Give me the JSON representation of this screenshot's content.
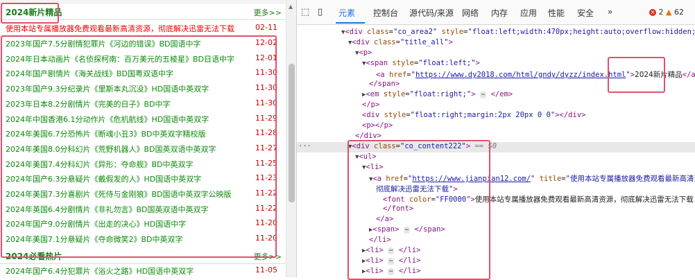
{
  "left": {
    "section1": {
      "title": "2024新片精品",
      "more": "更多>>"
    },
    "ad": {
      "title": "使用本站专属播放器免费观看最新高清资源，彻底解决迅雷无法下载",
      "date": "02-11"
    },
    "rows": [
      {
        "title": "2023年国产7.5分剧情犯罪片《河边的错误》BD国语中字",
        "date": "12-02"
      },
      {
        "title": "2024年日本动画片《名侦探柯南：百万美元的五棱星》BD日语中字",
        "date": "12-01"
      },
      {
        "title": "2024年国产剧情片《海关战线》BD国粤双语中字",
        "date": "11-30"
      },
      {
        "title": "2023年国产9.3分纪录片《里斯本丸沉没》HD国语中英双字",
        "date": "11-30"
      },
      {
        "title": "2023年日本8.2分剧情片《完美的日子》BD中字",
        "date": "11-30"
      },
      {
        "title": "2024年中国香港6.1分动作片《危机航线》HD国语中英双字",
        "date": "11-29"
      },
      {
        "title": "2024年美国6.7分恐怖片《断魂小丑3》BD中英双字精校版",
        "date": "11-28"
      },
      {
        "title": "2024年美国8.0分科幻片《荒野机器人》BD国英双语中英双字",
        "date": "11-27"
      },
      {
        "title": "2024年美国7.4分科幻片《异形：夺命舰》BD中英双字",
        "date": "11-25"
      },
      {
        "title": "2024年国产6.3分悬疑片《戴假发的人》HD国语中英双字",
        "date": "11-23"
      },
      {
        "title": "2024年美国7.3分喜剧片《死侍与金刚狼》BD国语中英双字公映版",
        "date": "11-22"
      },
      {
        "title": "2024年英国6.4分剧情片《非礼勿言》BD国英双语中英双字",
        "date": "11-22"
      },
      {
        "title": "2024年国产9.0分剧情片《出走的决心》HD国语中字",
        "date": "11-20"
      },
      {
        "title": "2024年美国7.1分悬疑片《夺命微笑2》BD中英双字",
        "date": "11-20"
      }
    ],
    "section2": {
      "title": "2024必看热片",
      "more": "更多>>"
    },
    "row_bottom": {
      "title": "2024年国产6.4分犯罪片《浴火之路》HD国语中英双字",
      "date": "11-05"
    }
  },
  "devtools": {
    "tabs": [
      "元素",
      "控制台",
      "源代码/来源",
      "网络",
      "内存",
      "应用",
      "性能",
      "安全"
    ],
    "more_tabs": "»",
    "error_count": "2",
    "warning_count": "62",
    "code": {
      "l1": {
        "tag": "div",
        "class": "co_area2",
        "style": "float:left;width:470px;height:auto;overflow:hidden;"
      },
      "l2": {
        "tag": "div",
        "class": "title_all"
      },
      "l3": {
        "tag": "p"
      },
      "l4": {
        "tag": "span",
        "style": "float:left;"
      },
      "l5": {
        "tag": "a",
        "href": "https://www.dy2018.com/html/gndy/dyzz/index.html",
        "text": "2024新片精品"
      },
      "l6": {
        "tag": "span"
      },
      "l7": {
        "tag": "em",
        "style": "float:right;"
      },
      "l8": {
        "tag": "p"
      },
      "l9": {
        "tag": "div",
        "style": "float:right;margin:2px 20px 0 0"
      },
      "l10": {
        "tag": "p"
      },
      "l11": {
        "tag": "div"
      },
      "l12": {
        "tag": "div",
        "class": "co_content222",
        "marker": "== $0",
        "gutter": "···"
      },
      "l13": {
        "tag": "ul"
      },
      "l14": {
        "tag": "li"
      },
      "l15": {
        "tag": "a",
        "href": "https://www.jianpian12.com/",
        "title": "使用本站专属播放器免费观看最新高清资源,",
        "title_cont": "彻底解决迅雷无法下载"
      },
      "l17": {
        "tag": "font",
        "color": "FF0000",
        "text": "使用本站专属播放器免费观看最新高清资源，彻底解决迅雷无法下载"
      },
      "l18": {
        "tag": "font"
      },
      "l19": {
        "tag": "a"
      },
      "l20": {
        "tag": "span"
      },
      "l21": {
        "tag": "li"
      },
      "l22": {
        "tag": "li"
      },
      "l23": {
        "tag": "li"
      },
      "l24": {
        "tag": "li"
      },
      "ellipsis": "⋯"
    }
  }
}
